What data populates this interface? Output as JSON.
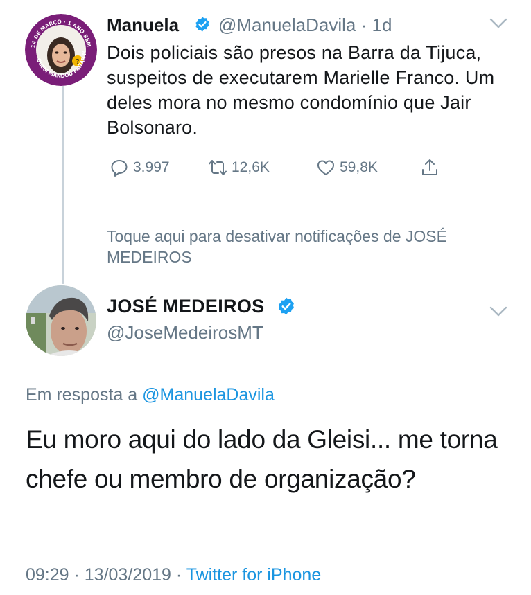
{
  "tweet1": {
    "name": "Manuela",
    "handle": "@ManuelaDavila",
    "time_sep": "·",
    "time": "1d",
    "text": "Dois policiais são presos na Barra da Tijuca, suspeitos de executarem Marielle Franco. Um deles mora no mesmo condomínio que Jair Bolsonaro.",
    "avatar_badge_text": "14 DE MARÇO · 1 ANO SEM RESPOSTA · QUEM MANDOU MATAR MARIELLE?",
    "stats": {
      "replies": "3.997",
      "retweets": "12,6K",
      "likes": "59,8K"
    }
  },
  "notification_toggle": "Toque aqui para desativar notificações de JOSÉ MEDEIROS",
  "tweet2": {
    "name": "JOSÉ MEDEIROS",
    "handle": "@JoseMedeirosMT",
    "reply_prefix": "Em resposta a",
    "reply_mention": "@ManuelaDavila",
    "text": "Eu moro aqui do lado da Gleisi... me torna chefe ou membro de organização?",
    "timestamp": "09:29 · 13/03/2019",
    "meta_sep": "·",
    "source": "Twitter for iPhone"
  },
  "colors": {
    "text": "#14171a",
    "secondary": "#657786",
    "link": "#1b95e0",
    "verified": "#1da1f2",
    "thread_line": "#c8d2da"
  },
  "icons": [
    "reply-icon",
    "retweet-icon",
    "like-icon",
    "share-icon",
    "verified-badge-icon",
    "chevron-down-icon"
  ]
}
